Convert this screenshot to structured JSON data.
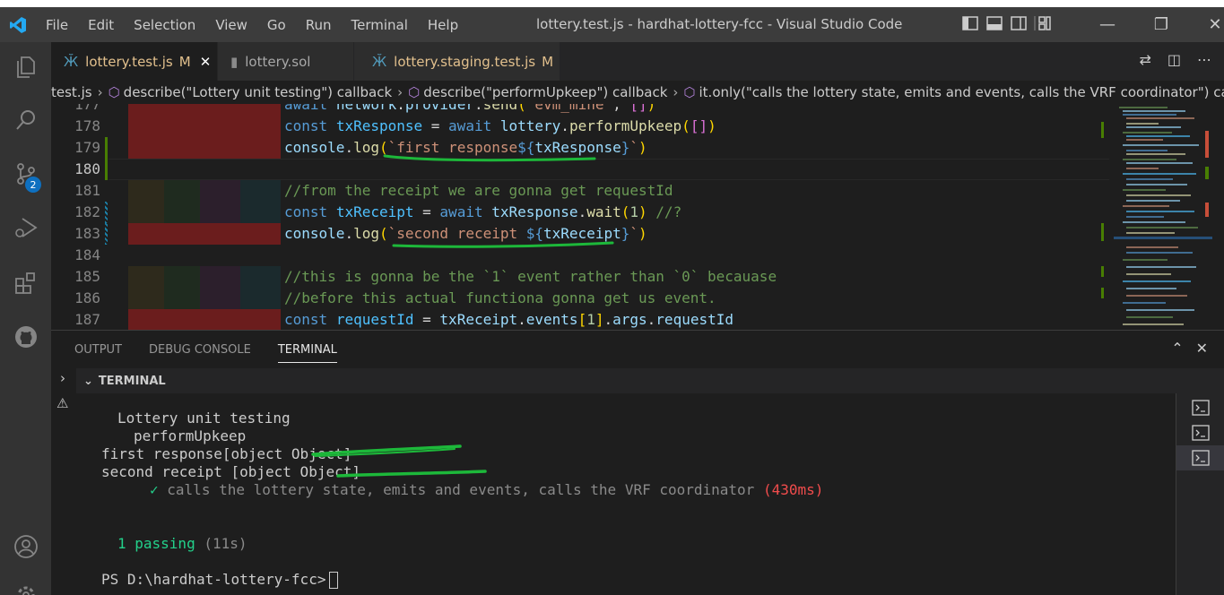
{
  "titlebar": {
    "menu": [
      "File",
      "Edit",
      "Selection",
      "View",
      "Go",
      "Run",
      "Terminal",
      "Help"
    ],
    "window_title": "lottery.test.js - hardhat-lottery-fcc - Visual Studio Code"
  },
  "activity": {
    "scm_badge": "2"
  },
  "tabs": [
    {
      "label": "lottery.test.js",
      "mark": "M",
      "active": true
    },
    {
      "label": "lottery.sol",
      "mark": "",
      "active": false
    },
    {
      "label": "lottery.staging.test.js",
      "mark": "M",
      "active": false
    }
  ],
  "breadcrumb": {
    "file": "test.js",
    "items": [
      "describe(\"Lottery unit testing\") callback",
      "describe(\"performUpkeep\") callback",
      "it.only(\"calls the lottery state, emits and events, calls the VRF coordinator\") callback"
    ]
  },
  "editor": {
    "line_numbers": [
      "177",
      "178",
      "179",
      "180",
      "181",
      "182",
      "183",
      "184",
      "185",
      "186",
      "187"
    ],
    "current_line": "180",
    "line177_text": "await network.provider.send(\"evm_mine\", [])",
    "line181_comment": "//from the receipt we are gonna get requestId",
    "line185_comment": "//this is gonna be the `1` event rather than `0` becauase",
    "line186_comment": "//before this actual functiona gonna get us event."
  },
  "panel": {
    "tabs": [
      "OUTPUT",
      "DEBUG CONSOLE",
      "TERMINAL"
    ],
    "active_tab": "TERMINAL",
    "terminal_header": "TERMINAL",
    "output": {
      "suite": "Lottery unit testing",
      "subsuite": "performUpkeep",
      "log1": "first response[object Object]",
      "log2": "second receipt [object Object]",
      "check": "✓",
      "test_name": "calls the lottery state, emits and events, calls the VRF coordinator",
      "duration": "(430ms)",
      "passing": "1 passing",
      "passing_time": "(11s)",
      "prompt": "PS D:\\hardhat-lottery-fcc>"
    }
  },
  "colors": {
    "accent": "#0e70c0",
    "modified": "#e2c08d",
    "annotation_green": "#1db83a"
  }
}
